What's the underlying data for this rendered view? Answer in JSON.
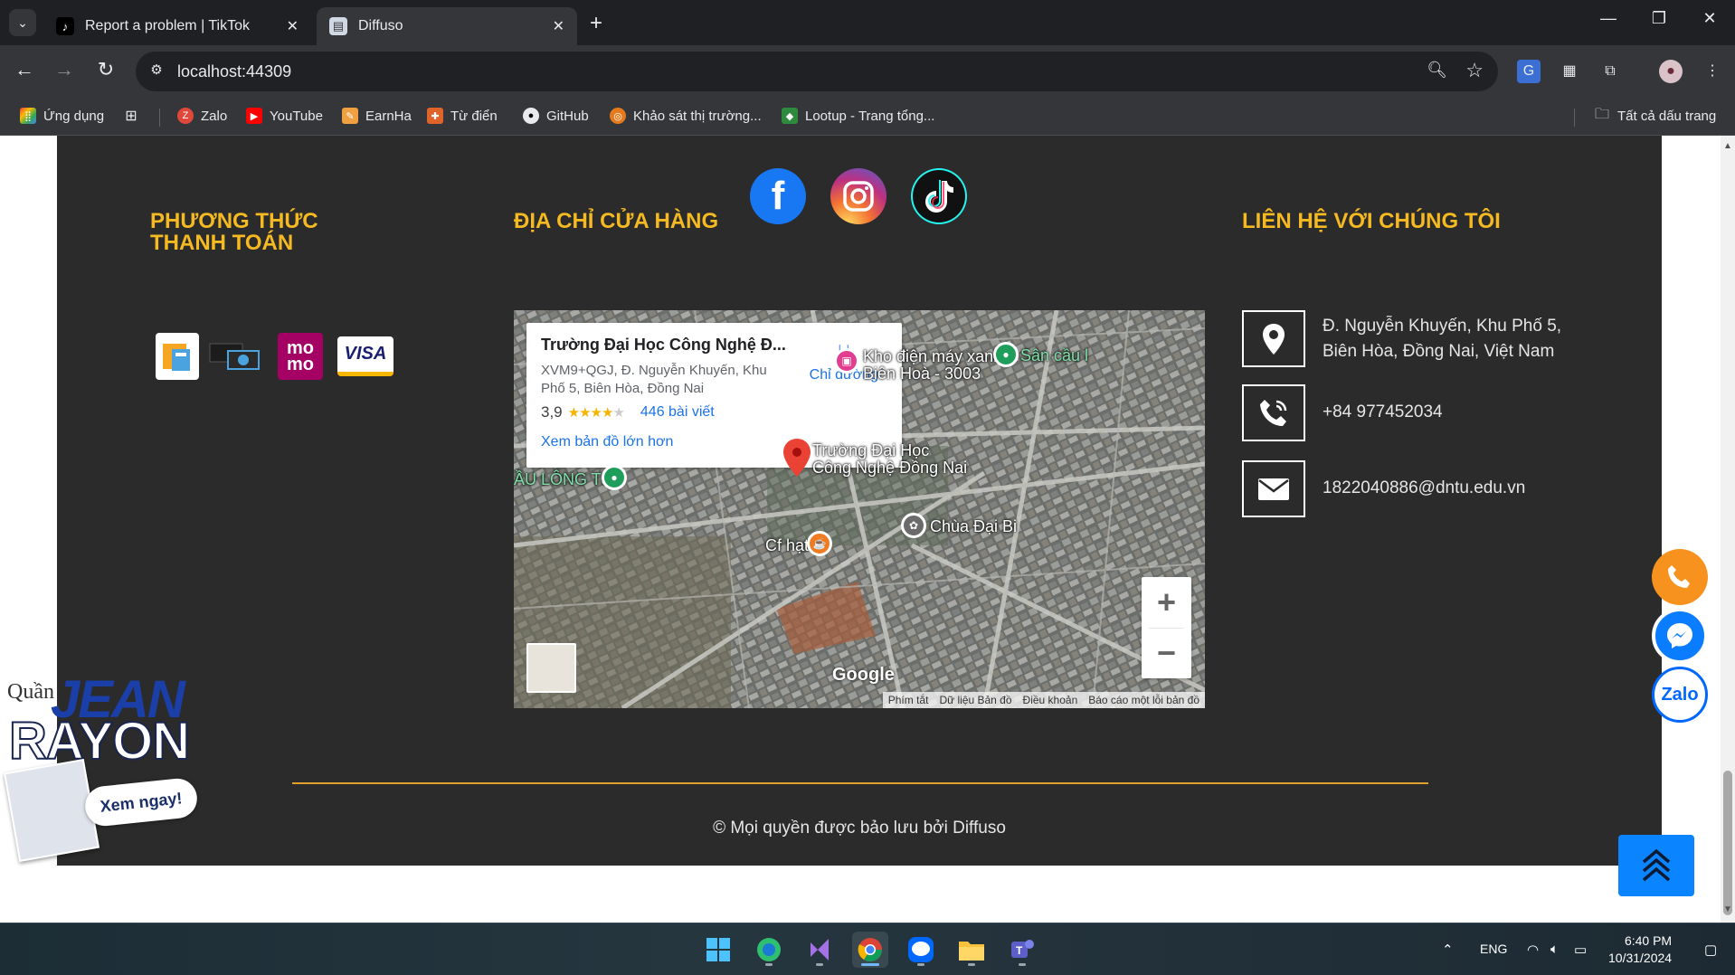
{
  "browser": {
    "tabs": [
      {
        "title": "Report a problem | TikTok",
        "active": false
      },
      {
        "title": "Diffuso",
        "active": true
      }
    ],
    "url": "localhost:44309",
    "bookmarks": [
      {
        "label": "Ứng dụng",
        "icon": "apps-grid-icon"
      },
      {
        "label": "Zalo",
        "icon": "zalo-icon"
      },
      {
        "label": "YouTube",
        "icon": "youtube-icon"
      },
      {
        "label": "EarnHa",
        "icon": "earnha-icon"
      },
      {
        "label": "Từ điển",
        "icon": "dictionary-icon"
      },
      {
        "label": "GitHub",
        "icon": "github-icon"
      },
      {
        "label": "Khảo sát thị trường...",
        "icon": "survey-icon"
      },
      {
        "label": "Lootup - Trang tổng...",
        "icon": "lootup-icon"
      }
    ],
    "all_bookmarks": "Tất cả dấu trang"
  },
  "footer": {
    "social": [
      "facebook-icon",
      "instagram-icon",
      "tiktok-icon"
    ],
    "payment_title": "PHƯƠNG THỨC THANH TOÁN",
    "payment_methods": [
      "bank-transfer-icon",
      "cash-icon",
      "momo-icon",
      "visa-icon"
    ],
    "momo_text": "mo",
    "visa_text": "VISA",
    "store_title": "ĐỊA CHỈ CỬA HÀNG",
    "contact_title": "LIÊN HỆ VỚI CHÚNG TÔI",
    "contact": {
      "address": "Đ. Nguyễn Khuyến, Khu Phố 5, Biên Hòa, Đồng Nai, Việt Nam",
      "phone": "+84 977452034",
      "email": "1822040886@dntu.edu.vn"
    },
    "copyright": "© Mọi quyền được bảo lưu bởi Diffuso"
  },
  "map": {
    "place_name": "Trường Đại Học Công Nghệ Đ...",
    "place_address": "XVM9+QGJ, Đ. Nguyễn Khuyến, Khu Phố 5, Biên Hòa, Đồng Nai",
    "rating": "3,9",
    "reviews": "446 bài viết",
    "directions": "Chỉ đường",
    "view_larger": "Xem bản đồ lớn hơn",
    "labels": {
      "kho_dien_may": "Kho điện máy xanh\nBiên Hoà - 3003",
      "san_cau": "Sân cầu l",
      "university": "Trường Đại Học\nCông Nghệ Đồng Nai",
      "cau_long": "ẦU LÔNG T&T",
      "chua": "Chùa Đại Bi",
      "cf": "Cf hạt",
      "google": "Google"
    },
    "zoom_in": "+",
    "zoom_out": "−",
    "attribution": [
      "Phím tắt",
      "Dữ liệu Bản đồ",
      "Điều khoản",
      "Báo cáo một lỗi bản đồ"
    ]
  },
  "promo": {
    "quan": "Quần",
    "jean": "JEAN",
    "rayon": "RAYON",
    "cta": "Xem ngay!"
  },
  "floating": {
    "zalo": "Zalo"
  },
  "taskbar": {
    "language": "ENG",
    "time": "6:40 PM",
    "date": "10/31/2024"
  }
}
